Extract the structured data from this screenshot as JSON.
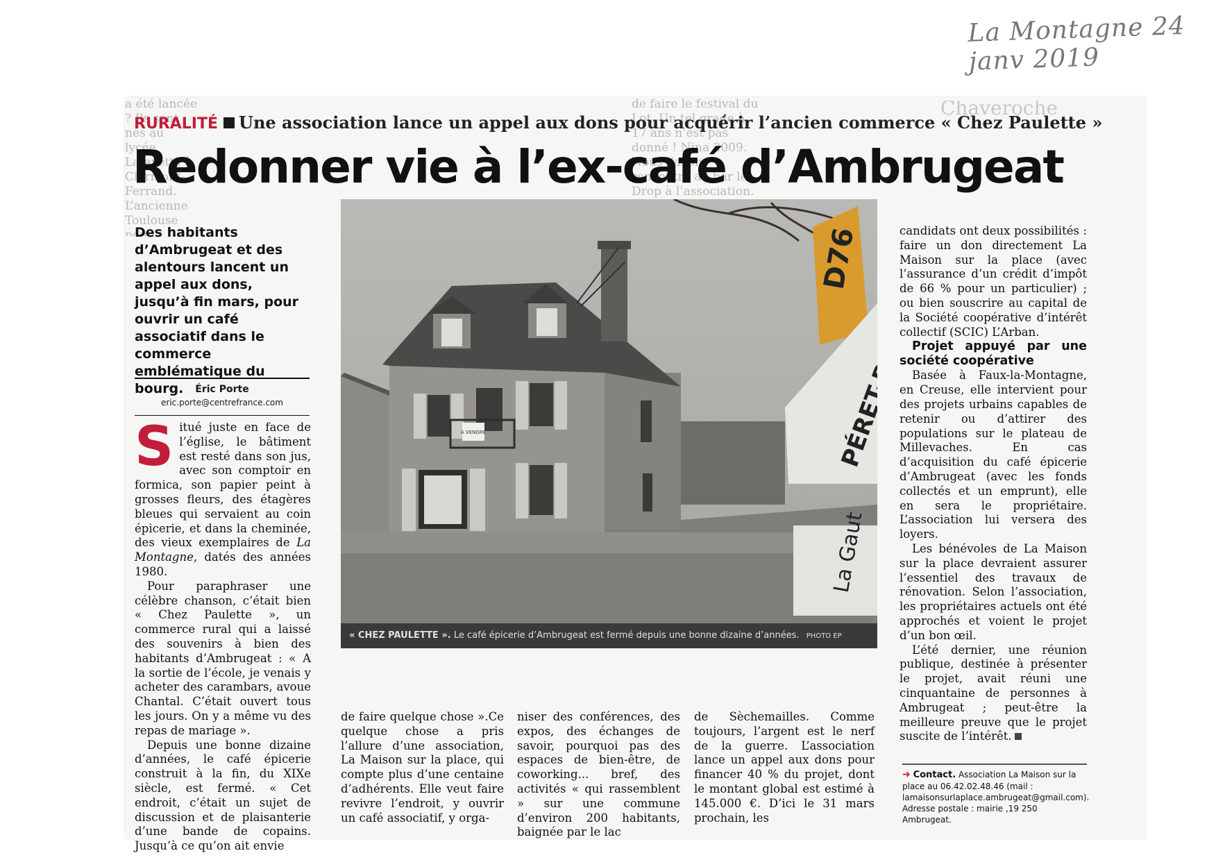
{
  "annotation": "La Montagne 24 janv 2019",
  "kicker": {
    "rubric": "RURALITÉ",
    "text": "Une association lance un appel aux dons pour acquérir l’ancien commerce « Chez Paulette »"
  },
  "headline": "Redonner vie à l’ex-café d’Ambrugeat",
  "lede": "Des habitants d’Ambrugeat et des alentours lancent un appel aux dons, jusqu’à fin mars, pour ouvrir un café associatif dans le commerce emblématique du bourg.",
  "byline": {
    "author": "Éric Porte",
    "email": "eric.porte@centrefrance.com"
  },
  "body": {
    "dropcap": "S",
    "p1_rest": "itué juste en face de l’église, le bâtiment est resté dans son jus, avec son comptoir en formica, son papier peint à grosses fleurs, des étagères bleues qui servaient au coin épicerie, et dans la cheminée, des vieux exemplaires de",
    "p1_italic": "La Montagne",
    "p1_end": ", datés des années 1980.",
    "p2": "Pour paraphraser une célèbre chanson, c’était bien « Chez Paulette », un commerce rural qui a laissé des souvenirs à bien des habitants d’Ambrugeat : « A la sortie de l’école, je venais y acheter des carambars, avoue Chantal. C’était ouvert tous les jours. On y a même vu des repas de mariage ».",
    "p3": "Depuis une bonne dizaine d’années, le café épicerie construit à la fin, du XIXe siècle, est fermé. « Cet endroit, c’était un sujet de discussion et de plaisanterie d’une bande de copains. Jusqu’à ce qu’on ait envie",
    "col2": "de faire quelque chose ».Ce quelque chose a pris l’allure d’une association, La Maison sur la place, qui compte plus d’une centaine d’adhérents. Elle veut faire revivre l’endroit, y ouvrir un café associatif, y orga-",
    "col3": "niser des conférences, des expos, des échanges de savoir, pourquoi pas des espaces de bien-être, de coworking... bref, des activités « qui rassemblent » sur une commune d’environ 200 habitants, baignée par le lac",
    "col4": "de Sèchemailles. Comme toujours, l’argent est le nerf de la guerre. L’association lance un appel aux dons pour financer 40 % du projet, dont le montant global est estimé à 145.000 €. D’ici le 31 mars prochain, les",
    "col5_p1": "candidats ont deux possibilités : faire un don directement La Maison sur la place (avec l’assurance d’un crédit d’impôt de 66 % pour un particulier) ; ou bien souscrire au capital de la Société coopérative d’intérêt collectif (SCIC) L’Arban.",
    "subhead": "Projet appuyé par une société coopérative",
    "col5_p2": "Basée à Faux-la-Montagne, en Creuse, elle intervient pour des projets urbains capables de retenir ou d’attirer des populations sur le plateau de Millevaches. En cas d’acquisition du café épicerie d’Ambrugeat (avec les fonds collectés et un emprunt), elle en sera le propriétaire. L’association lui versera des loyers.",
    "col5_p3": "Les bénévoles de La Maison sur la place devraient assurer l’essentiel des travaux de rénovation. Selon l’association, les propriétaires actuels ont été approchés et voient le projet d’un bon œil.",
    "col5_p4": "L’été dernier, une réunion publique, destinée à présenter le projet, avait réuni une cinquantaine de personnes à Ambrugeat ; peut-être la meilleure preuve que le projet suscite de l’intérêt."
  },
  "photo": {
    "caption_title": "« CHEZ PAULETTE ».",
    "caption_text": "Le café épicerie d’Ambrugeat est fermé depuis une bonne dizaine d’années.",
    "credit": "PHOTO EP",
    "shop_sign": "A VENDRE",
    "road_sign_1": "D76",
    "road_sign_2": "PÉRET-BEL",
    "road_sign_3": "La Gaut"
  },
  "contact": {
    "label": "Contact.",
    "text": "Association La Maison sur la place au 06.42.02.48.46 (mail : lamaisonsurlaplace.ambrugeat@gmail.com). Adresse postale : mairie ,19 250 Ambrugeat."
  },
  "bleed": {
    "left": "a été lancée ? Ils sont nés au lycée Lafayette à Clermont-Ferrand. L’ancienne Toulouse pour devenir pilote.",
    "center": "de faire le festival du Lot. Un tel grade à 17 ans n’est pas donné ! Nina 2009. Nous l’avons rencontré au bar le Drop à l’association.",
    "right": "Chaveroche"
  }
}
